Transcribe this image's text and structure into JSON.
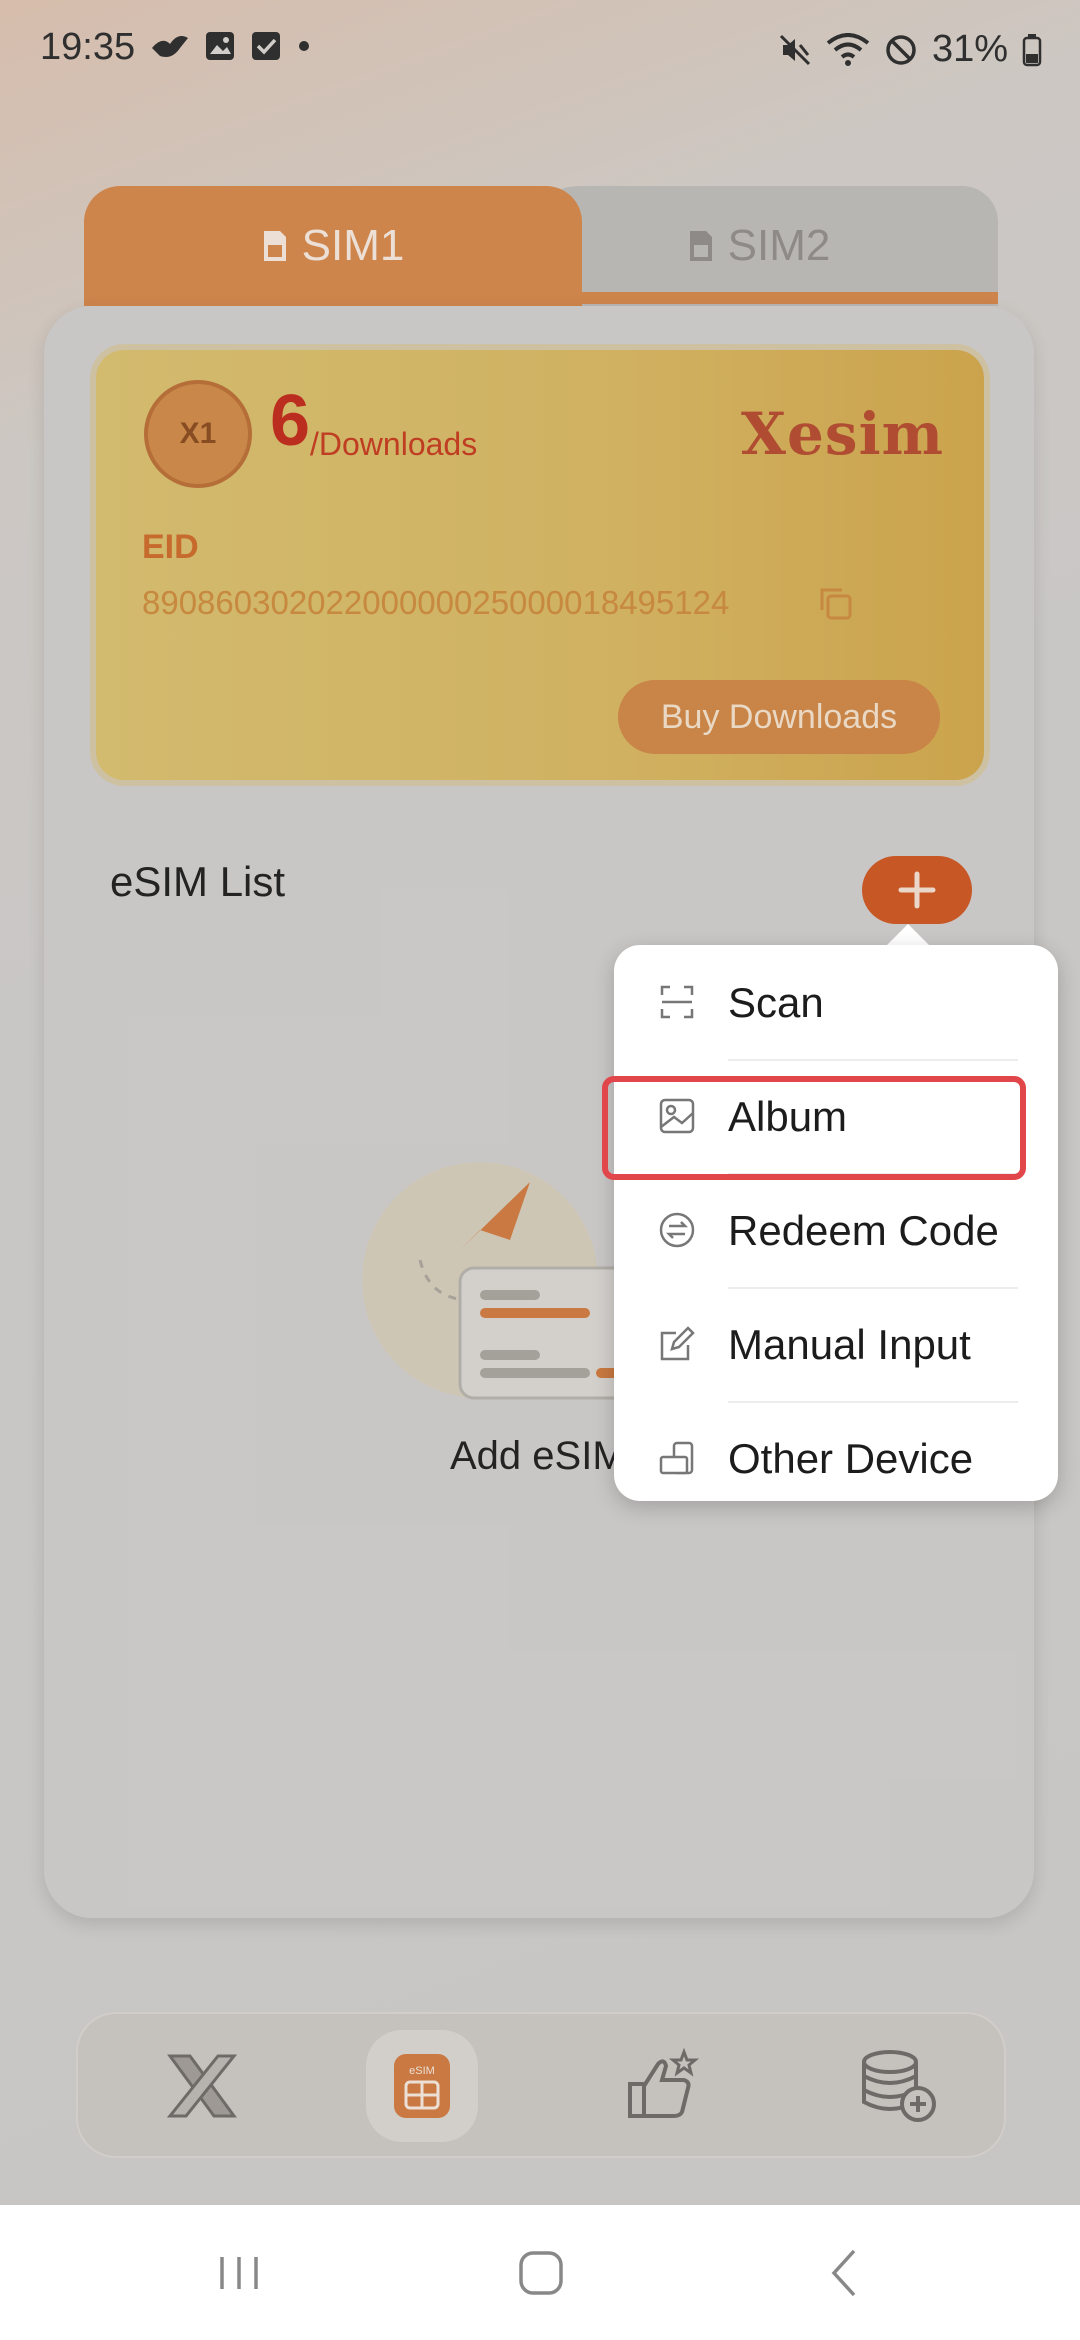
{
  "status_bar": {
    "time": "19:35",
    "battery": "31%"
  },
  "tabs": [
    {
      "label": "SIM1",
      "active": true
    },
    {
      "label": "SIM2",
      "active": false
    }
  ],
  "card": {
    "badge_text": "X1",
    "downloads_count": "6",
    "downloads_label": "/Downloads",
    "brand": "Xesim",
    "eid_label": "EID",
    "eid_value": "89086030202200000025000018495124",
    "buy_label": "Buy Downloads"
  },
  "esim_list": {
    "title": "eSIM List",
    "empty_text": "Add eSIM"
  },
  "menu": {
    "items": [
      {
        "label": "Scan",
        "icon": "scan-icon"
      },
      {
        "label": "Album",
        "icon": "image-icon"
      },
      {
        "label": "Redeem Code",
        "icon": "exchange-icon"
      },
      {
        "label": "Manual Input",
        "icon": "edit-icon"
      },
      {
        "label": "Other Device",
        "icon": "devices-icon"
      }
    ],
    "highlighted_item": "Album"
  },
  "bottom_nav": [
    {
      "name": "home",
      "icon": "x-logo-icon"
    },
    {
      "name": "esim",
      "icon": "esim-icon",
      "active": true,
      "icon_text": "eSIM"
    },
    {
      "name": "recommend",
      "icon": "thumbs-up-icon"
    },
    {
      "name": "points",
      "icon": "coins-icon"
    }
  ],
  "colors": {
    "accent": "#cd5520",
    "tab_active": "#d4864a",
    "highlight": "#e1474a"
  }
}
